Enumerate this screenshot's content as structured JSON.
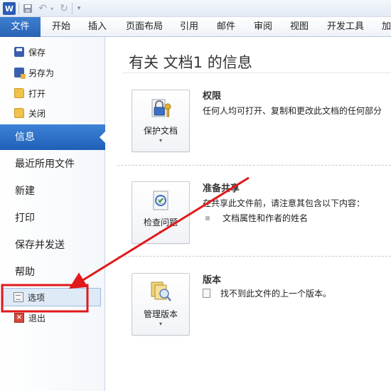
{
  "quick_access": {
    "word_logo": "W",
    "icons": [
      "save-icon",
      "undo-icon",
      "redo-icon",
      "customize-icon"
    ]
  },
  "ribbon": {
    "tabs": [
      {
        "id": "file",
        "label": "文件"
      },
      {
        "id": "home",
        "label": "开始"
      },
      {
        "id": "insert",
        "label": "插入"
      },
      {
        "id": "layout",
        "label": "页面布局"
      },
      {
        "id": "references",
        "label": "引用"
      },
      {
        "id": "mailings",
        "label": "邮件"
      },
      {
        "id": "review",
        "label": "审阅"
      },
      {
        "id": "view",
        "label": "视图"
      },
      {
        "id": "developer",
        "label": "开发工具"
      },
      {
        "id": "addins",
        "label": "加"
      }
    ]
  },
  "backstage": {
    "commands": {
      "save": "保存",
      "save_as": "另存为",
      "open": "打开",
      "close": "关闭",
      "options": "选项",
      "exit": "退出"
    },
    "nav": {
      "info": "信息",
      "recent": "最近所用文件",
      "new": "新建",
      "print": "打印",
      "save_send": "保存并发送",
      "help": "帮助"
    }
  },
  "info_page": {
    "title": "有关 文档1 的信息",
    "permissions": {
      "button": "保护文档",
      "heading": "权限",
      "desc": "任何人均可打开、复制和更改此文档的任何部分"
    },
    "prepare": {
      "button": "检查问题",
      "heading": "准备共享",
      "desc": "在共享此文件前，请注意其包含以下内容：",
      "item": "文档属性和作者的姓名"
    },
    "versions": {
      "button": "管理版本",
      "heading": "版本",
      "item": "找不到此文件的上一个版本。"
    }
  },
  "colors": {
    "file_tab": "#2a63b4",
    "selected_nav": "#1f5fb8",
    "annotation": "#e0191b"
  }
}
